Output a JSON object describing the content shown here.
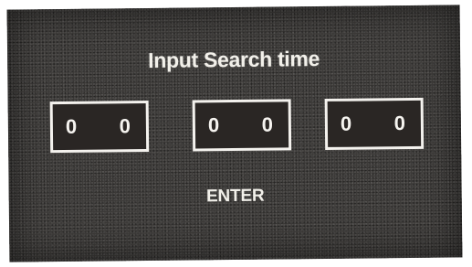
{
  "dialog": {
    "title": "Input Search time",
    "fields": [
      {
        "digits": [
          "0",
          "0"
        ]
      },
      {
        "digits": [
          "0",
          "0"
        ]
      },
      {
        "digits": [
          "0",
          "0"
        ]
      }
    ],
    "enter_label": "ENTER"
  }
}
